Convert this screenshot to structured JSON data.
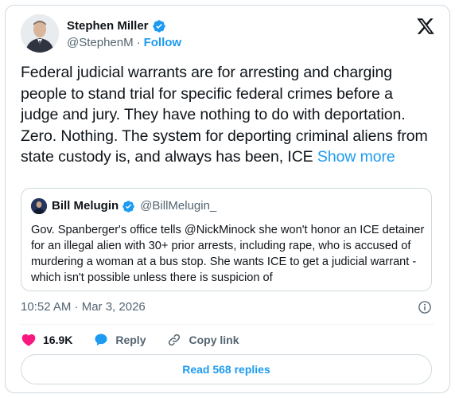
{
  "author": {
    "name": "Stephen Miller",
    "handle": "@StephenM",
    "separator": "·",
    "follow_label": "Follow"
  },
  "tweet": {
    "text": "Federal judicial warrants are for arresting and charging people to stand trial for specific federal crimes before a judge and jury. They have nothing to do with deportation. Zero. Nothing. The system for deporting criminal aliens from state custody is, and always has been, ICE",
    "show_more_label": "Show more"
  },
  "quote": {
    "name": "Bill Melugin",
    "handle": "@BillMelugin_",
    "text": "Gov. Spanberger's office tells @NickMinock she won't honor an ICE detainer for an illegal alien with 30+ prior arrests, including rape, who is accused of murdering a woman at a bus stop. She wants ICE to get a judicial warrant - which isn't possible unless there is suspicion of"
  },
  "meta": {
    "timestamp": "10:52 AM · Mar 3, 2026"
  },
  "actions": {
    "likes": "16.9K",
    "reply_label": "Reply",
    "copy_link_label": "Copy link"
  },
  "read_replies_label": "Read 568 replies",
  "colors": {
    "accent": "#1d9bf0",
    "like": "#f91880",
    "text": "#0f1419",
    "secondary": "#536471",
    "border": "#cfd9de"
  },
  "icons": [
    "verified-badge-icon",
    "x-logo-icon",
    "info-icon",
    "heart-icon",
    "reply-icon",
    "link-icon"
  ]
}
